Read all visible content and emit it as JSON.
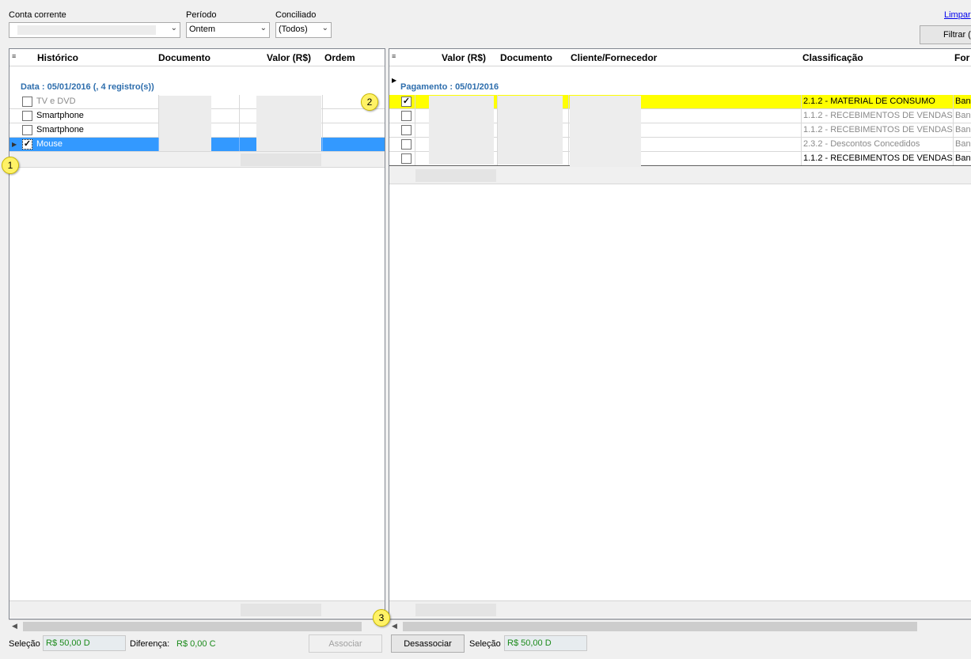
{
  "filters": {
    "account_label": "Conta corrente",
    "account_value": "",
    "period_label": "Período",
    "period_value": "Ontem",
    "reconciled_label": "Conciliado",
    "reconciled_value": "(Todos)",
    "clear_link": "Limpar",
    "filter_button": "Filtrar ("
  },
  "left_grid": {
    "columns": [
      "Histórico",
      "Documento",
      "Valor (R$)",
      "Ordem"
    ],
    "group_label": "Data : 05/01/2016 (, 4 registro(s))",
    "rows": [
      {
        "historico": "TV e DVD",
        "checked": false
      },
      {
        "historico": "Smartphone",
        "checked": false
      },
      {
        "historico": "Smartphone",
        "checked": false
      },
      {
        "historico": "Mouse",
        "checked": true
      }
    ]
  },
  "right_grid": {
    "columns": [
      "Valor (R$)",
      "Documento",
      "Cliente/Fornecedor",
      "Classificação",
      "For"
    ],
    "group_label": "Pagamento : 05/01/2016",
    "rows": [
      {
        "classificacao": "2.1.2 - MATERIAL DE CONSUMO",
        "forma": "Banc",
        "checked": true
      },
      {
        "classificacao": "1.1.2 - RECEBIMENTOS DE VENDAS",
        "forma": "Banc",
        "checked": false
      },
      {
        "classificacao": "1.1.2 - RECEBIMENTOS DE VENDAS",
        "forma": "Banc",
        "checked": false
      },
      {
        "classificacao": "2.3.2 - Descontos Concedidos",
        "forma": "Banc",
        "checked": false
      },
      {
        "classificacao": "1.1.2 - RECEBIMENTOS DE VENDAS",
        "forma": "Banc",
        "checked": false
      }
    ]
  },
  "footer": {
    "selection_label": "Seleção",
    "left_selection_value": "R$ 50,00 D",
    "difference_label": "Diferença:",
    "difference_value": "R$ 0,00 C",
    "associate_button": "Associar",
    "disassociate_button": "Desassociar",
    "right_selection_label": "Seleção",
    "right_selection_value": "R$ 50,00 D"
  },
  "callouts": [
    "1",
    "2",
    "3"
  ],
  "colors": {
    "selected_row": "#3399ff",
    "highlight_row": "#ffff00",
    "group_text": "#2e6ead",
    "totals_text": "#1a8a1a"
  }
}
